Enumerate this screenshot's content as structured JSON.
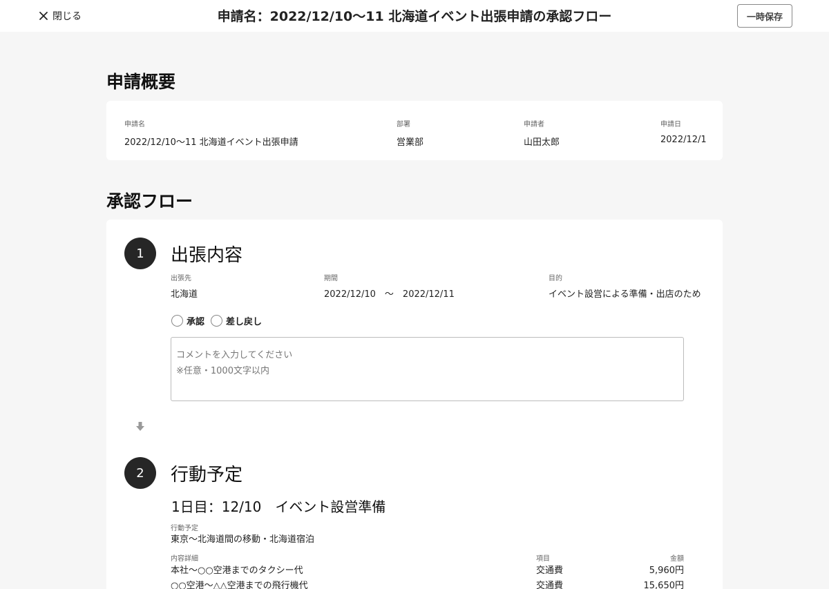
{
  "header": {
    "close_label": "閉じる",
    "title": "申請名：2022/12/10〜11 北海道イベント出張申請の承認フロー",
    "save_label": "一時保存"
  },
  "summary": {
    "heading": "申請概要",
    "fields": [
      {
        "label": "申請名",
        "value": "2022/12/10〜11 北海道イベント出張申請"
      },
      {
        "label": "部署",
        "value": "営業部"
      },
      {
        "label": "申請者",
        "value": "山田太郎"
      },
      {
        "label": "申請日",
        "value": "2022/12/1"
      }
    ]
  },
  "flow": {
    "heading": "承認フロー",
    "step1": {
      "number": "1",
      "title": "出張内容",
      "fields": [
        {
          "label": "出張先",
          "value": "北海道"
        },
        {
          "label": "期間",
          "value": "2022/12/10　〜　2022/12/11"
        },
        {
          "label": "目的",
          "value": "イベント設営による準備・出店のため"
        }
      ],
      "radio_approve": "承認",
      "radio_return": "差し戻し",
      "comment_placeholder": "コメントを入力してください\n※任意・1000文字以内"
    },
    "step2": {
      "number": "2",
      "title": "行動予定",
      "day_title": "1日目：12/10　イベント設営準備",
      "plan_label": "行動予定",
      "plan_value": "東京〜北海道間の移動・北海道宿泊",
      "table": {
        "headers": {
          "detail": "内容詳細",
          "item": "項目",
          "amount": "金額"
        },
        "rows": [
          {
            "detail": "本社〜○○空港までのタクシー代",
            "item": "交通費",
            "amount": "5,960円"
          },
          {
            "detail": "○○空港〜△△空港までの飛行機代",
            "item": "交通費",
            "amount": "15,650円"
          }
        ]
      }
    }
  },
  "icons": {
    "close": "close-icon",
    "arrow": "arrow-down-icon"
  },
  "colors": {
    "step_circle": "#262626",
    "background": "#f6f6f6"
  }
}
